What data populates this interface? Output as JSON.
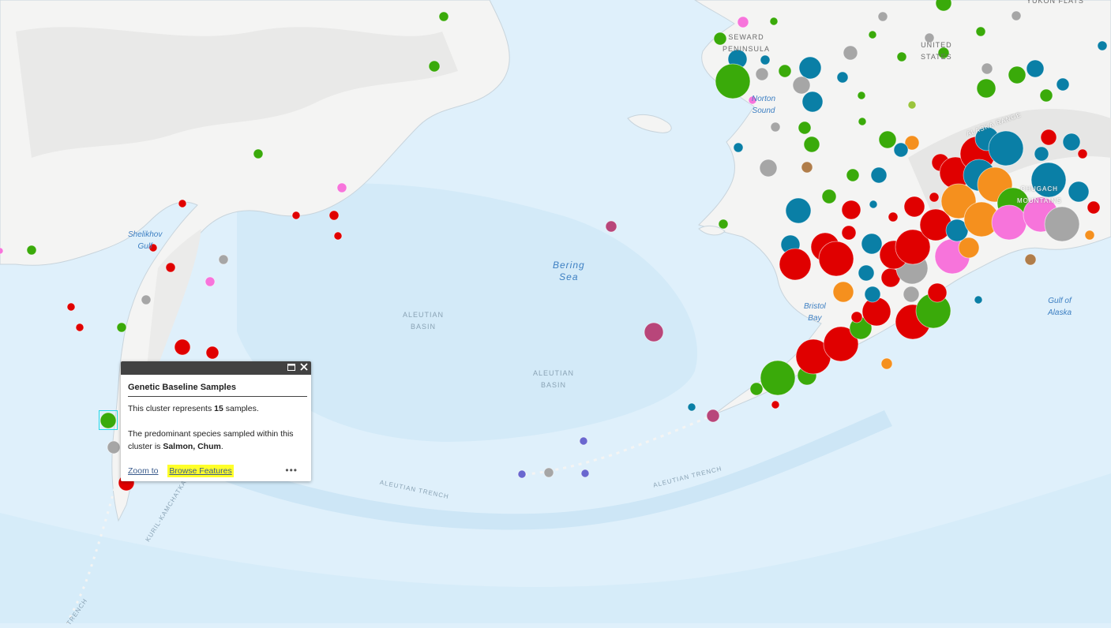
{
  "map": {
    "colors": {
      "water": "#dff0fb",
      "deep_water": "#cfe7f6",
      "land": "#f4f4f3",
      "land_relief": "#e7e7e6",
      "coast": "#c8d4dc"
    },
    "labels": {
      "seward": "SEWARD\nPENINSULA",
      "united_states": "UNITED\nSTATES",
      "yukon_flats": "YUKON FLATS",
      "norton_sound": "Norton\nSound",
      "alaska_range": "ALASKA RANGE",
      "chugach": "CHUGACH\nMOUNTAINS",
      "shelikhov": "Shelikhov\nGulf",
      "bering_sea": "Bering\nSea",
      "aleutian_basin_1": "ALEUTIAN\nBASIN",
      "aleutian_basin_2": "ALEUTIAN\nBASIN",
      "bristol_bay": "Bristol\nBay",
      "gulf_of_alaska": "Gulf of\nAlaska",
      "aleutian_trench_w": "ALEUTIAN TRENCH",
      "aleutian_trench_e": "ALEUTIAN TRENCH",
      "kuril": "KURIL-KAMCHATKA",
      "trench_sw": "TRENCH"
    },
    "legend_colors": {
      "green": "#3aaa0a",
      "red": "#e00000",
      "teal": "#0a7fa6",
      "gray": "#a6a6a6",
      "orange": "#f5901e",
      "pink": "#f774db",
      "magenta": "#b8467a",
      "purple": "#6a67cf",
      "brown": "#b07d4a",
      "lime": "#9ac43c"
    }
  },
  "popup": {
    "title": "Genetic Baseline Samples",
    "line1_pre": "This cluster represents ",
    "line1_count": "15",
    "line1_post": " samples.",
    "line2_pre": "The predominant species sampled within this cluster is ",
    "line2_species": "Salmon, Chum",
    "line2_post": ".",
    "zoom_to": "Zoom to",
    "browse_features": "Browse Features",
    "more": "•••",
    "maximize_icon": "maximize-icon",
    "close_icon": "close-icon"
  }
}
